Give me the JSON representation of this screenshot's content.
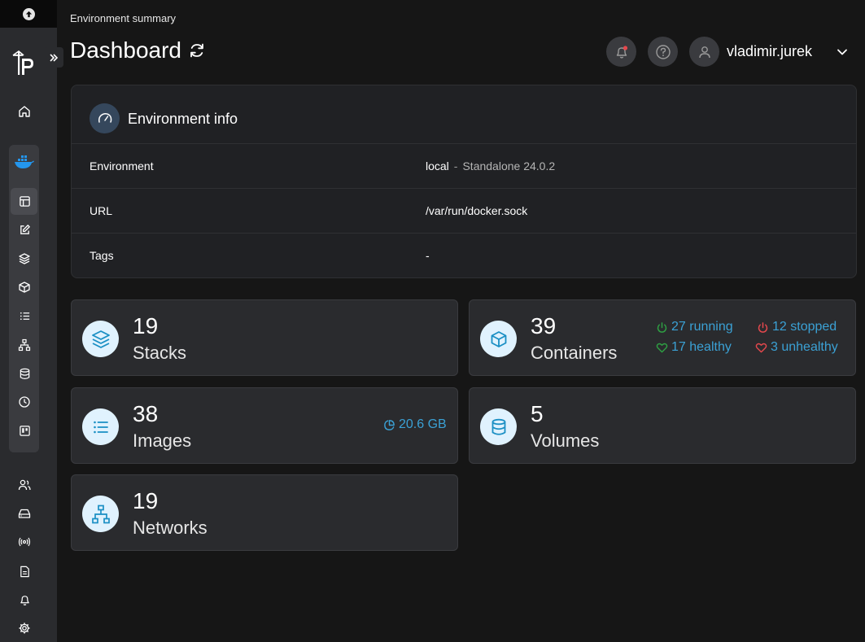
{
  "header": {
    "breadcrumb": "Environment summary",
    "title": "Dashboard",
    "user": "vladimir.jurek"
  },
  "environment_info": {
    "title": "Environment info",
    "rows": [
      {
        "label": "Environment",
        "name": "local",
        "separator": "-",
        "detail": "Standalone 24.0.2"
      },
      {
        "label": "URL",
        "value": "/var/run/docker.sock"
      },
      {
        "label": "Tags",
        "value": "-"
      }
    ]
  },
  "stats": {
    "stacks": {
      "count": "19",
      "label": "Stacks"
    },
    "containers": {
      "count": "39",
      "label": "Containers",
      "running": "27 running",
      "stopped": "12 stopped",
      "healthy": "17 healthy",
      "unhealthy": "3 unhealthy"
    },
    "images": {
      "count": "38",
      "label": "Images",
      "size": "20.6 GB"
    },
    "volumes": {
      "count": "5",
      "label": "Volumes"
    },
    "networks": {
      "count": "19",
      "label": "Networks"
    }
  },
  "colors": {
    "accent": "#3ba1d5",
    "running": "#2ea043",
    "stopped": "#e5484d",
    "icon_circle": "#e0f2fe",
    "docker": "#2496ed"
  },
  "icons": {
    "sidebar": [
      "home-icon",
      "docker-icon",
      "dashboard-icon",
      "edit-icon",
      "layers-icon",
      "box-icon",
      "list-icon",
      "network-icon",
      "database-icon",
      "clock-icon",
      "board-icon",
      "users-icon",
      "drive-icon",
      "broadcast-icon",
      "file-icon",
      "bell-icon",
      "gear-icon"
    ]
  }
}
